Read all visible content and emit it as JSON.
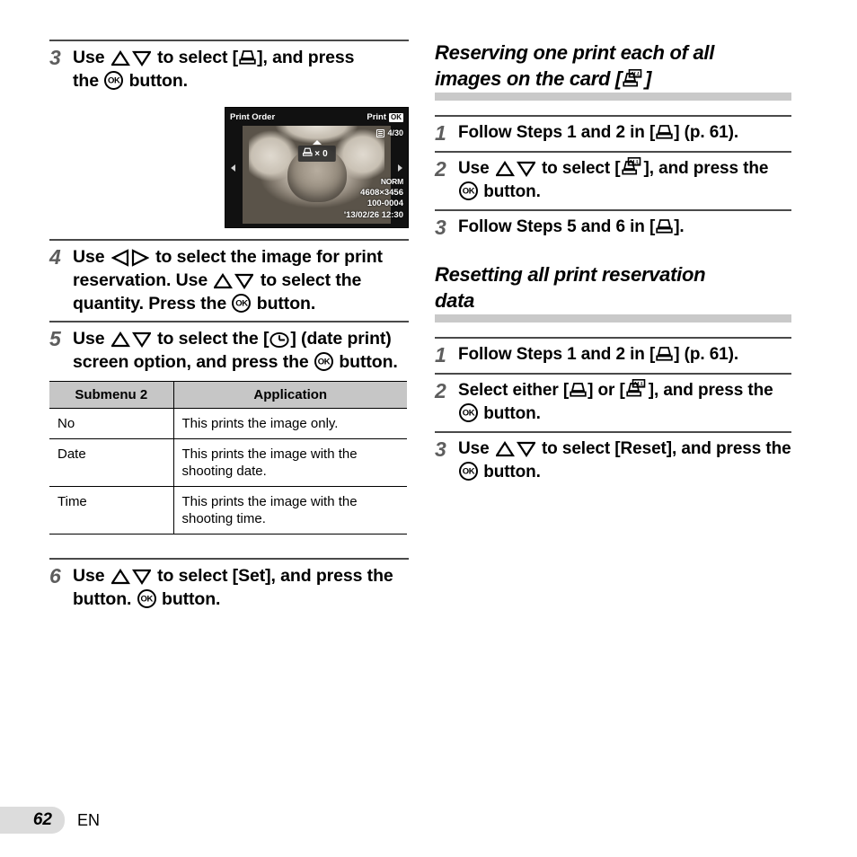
{
  "page": {
    "number": "62",
    "language": "EN"
  },
  "left_column": {
    "steps": [
      {
        "num": "3",
        "text_parts": [
          "Use ",
          "ARROW_UD",
          " to select [",
          "PRINTER",
          "], and press the ",
          "OK",
          " button."
        ],
        "plain": "Use △▽ to select [print], and press the OK button."
      },
      {
        "num": "4",
        "plain": "Use ◁▷ to select the image for print reservation. Use △▽ to select the quantity. Press the OK button."
      },
      {
        "num": "5",
        "plain": "Use △▽ to select the [date] (date print) screen option, and press the OK button."
      },
      {
        "num": "6",
        "plain": "Use △▽ to select [Set], and press the OK button."
      }
    ],
    "step3": {
      "w1": "Use",
      "w2": "to select [",
      "w3": "], and press",
      "w4": "the",
      "w5": "button."
    },
    "step4": {
      "w1": "Use",
      "w2": "to select the image for print reservation. Use",
      "w3": "to select the quantity. Press the",
      "w4": "button."
    },
    "step5": {
      "w1": "Use",
      "w2": "to select the [",
      "w3": "] (date print) screen option, and press the",
      "w4": "button."
    },
    "step6": {
      "w1": "Use",
      "w2": "to select [Set], and press the",
      "w3": "button."
    },
    "lcd": {
      "title": "Print Order",
      "print_label": "Print",
      "ok_badge": "OK",
      "frame_count": "4/30",
      "copies_label": "×",
      "copies_value": "0",
      "quality": "NORM",
      "resolution": "4608×3456",
      "file_no": "100-0004",
      "datetime": "'13/02/26  12:30"
    },
    "table": {
      "headers": [
        "Submenu 2",
        "Application"
      ],
      "rows": [
        [
          "No",
          "This prints the image only."
        ],
        [
          "Date",
          "This prints the image with the shooting date."
        ],
        [
          "Time",
          "This prints the image with the shooting time."
        ]
      ]
    }
  },
  "right_column": {
    "section1": {
      "heading_line1": "Reserving one print each of all",
      "heading_line2_pre": "images on the card [",
      "heading_line2_post": "]",
      "steps": {
        "s1": {
          "num": "1",
          "pre": "Follow Steps 1 and 2 in [",
          "post": "] (p. 61)."
        },
        "s2": {
          "num": "2",
          "w1": "Use",
          "w2": "to select [",
          "w3": "], and press the",
          "w4": "button."
        },
        "s3": {
          "num": "3",
          "pre": "Follow Steps 5 and 6 in [",
          "post": "]."
        }
      }
    },
    "section2": {
      "heading_line1": "Resetting all print reservation",
      "heading_line2": "data",
      "steps": {
        "s1": {
          "num": "1",
          "pre": "Follow Steps 1 and 2 in [",
          "post": "] (p. 61)."
        },
        "s2": {
          "num": "2",
          "w1": "Select either [",
          "w2": "] or [",
          "w3": "], and press the",
          "w4": "button."
        },
        "s3": {
          "num": "3",
          "w1": "Use",
          "w2": "to select [Reset], and press the",
          "w3": "button."
        }
      }
    }
  },
  "icons": {
    "printer": "printer-icon",
    "printer_all": "printer-all-icon",
    "ok": "ok-button-icon",
    "arrow_up_down": "arrow-up-down-icon",
    "arrow_left_right": "arrow-left-right-icon",
    "date": "date-clock-icon"
  },
  "colors": {
    "rule": "#4a4a4a",
    "step_number": "#5d5d5d",
    "table_header_bg": "#c6c6c6",
    "heading_bar": "#c9c9c9",
    "page_tab_bg": "#dcdcdc"
  }
}
